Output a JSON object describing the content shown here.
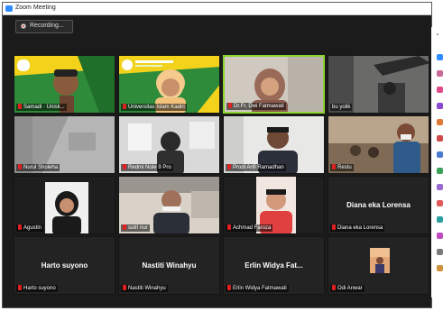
{
  "window": {
    "title": "Zoom Meeting"
  },
  "recording": {
    "label": "Recording..."
  },
  "tiles": [
    {
      "id": "semadi",
      "label": "Samadi · Unisk..."
    },
    {
      "id": "uniska",
      "label": "Universitas Islam Kadiri"
    },
    {
      "id": "dwi",
      "label": "Dr.Fr. Dwi Fatmawati"
    },
    {
      "id": "yolik",
      "label": "bu yolik"
    },
    {
      "id": "nur",
      "label": "Nurul Sholeha"
    },
    {
      "id": "redmi",
      "label": "Redmi Note 9 Pro"
    },
    {
      "id": "arif",
      "label": "Prodi Arifi Ramadhan"
    },
    {
      "id": "restu",
      "label": "Restu"
    },
    {
      "id": "agustin",
      "label": "Agustin"
    },
    {
      "id": "sutri",
      "label": "sutri nur"
    },
    {
      "id": "achmad",
      "label": "Achmad Faroza"
    },
    {
      "id": "diana",
      "label": "Diana eka Lorensa",
      "avatar": "Diana eka Lorensa"
    },
    {
      "id": "harto",
      "label": "Harto suyono",
      "avatar": "Harto suyono"
    },
    {
      "id": "nastiti",
      "label": "Nastiti Winahyu",
      "avatar": "Nastiti Winahyu"
    },
    {
      "id": "erlin",
      "label": "Erlin Widya Fatmawati",
      "avatar": "Erlin Widya Fat..."
    },
    {
      "id": "odi",
      "label": "Odi Anwar"
    }
  ],
  "banner": {
    "text": "Prosiding Ilmiah Nasional Universitas Islam Kadiri"
  },
  "colors": {
    "active_border": "#8dd430",
    "banner_green": "#2e8b3a",
    "banner_yellow": "#f2d21b",
    "mic_muted": "#e02020"
  }
}
